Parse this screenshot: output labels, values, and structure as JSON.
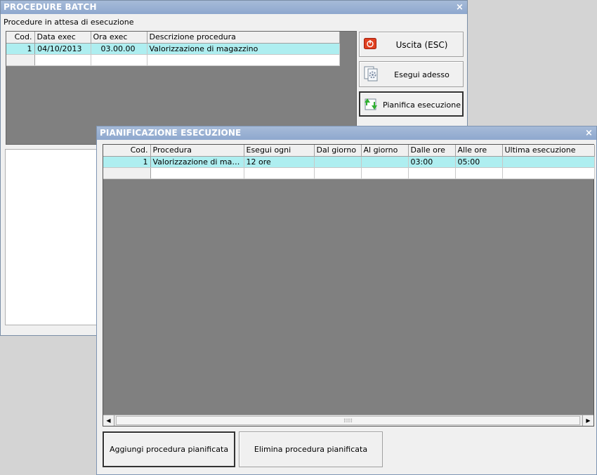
{
  "batch": {
    "title": "PROCEDURE BATCH",
    "close_glyph": "×",
    "subtitle": "Procedure in attesa di esecuzione",
    "columns": [
      "Cod.",
      "Data exec",
      "Ora exec",
      "Descrizione procedura"
    ],
    "rows": [
      [
        "1",
        "04/10/2013",
        "03.00.00",
        "Valorizzazione di magazzino"
      ]
    ],
    "buttons": {
      "exit": "Uscita (ESC)",
      "run_now": "Esegui adesso",
      "schedule": "Pianifica esecuzione"
    }
  },
  "plan": {
    "title": "PIANIFICAZIONE ESECUZIONE",
    "close_glyph": "×",
    "columns": [
      "Cod.",
      "Procedura",
      "Esegui ogni",
      "Dal giorno",
      "Al giorno",
      "Dalle ore",
      "Alle ore",
      "Ultima esecuzione"
    ],
    "rows": [
      [
        "1",
        "Valorizzazione di magazzino",
        "12 ore",
        "",
        "",
        "03:00",
        "05:00",
        ""
      ]
    ],
    "buttons": {
      "add": "Aggiungi procedura pianificata",
      "delete": "Elimina procedura pianificata"
    }
  },
  "colors": {
    "title_bar": "#8ea8ce",
    "grid_empty": "#808080",
    "selected_row": "#aeeef0",
    "exit_icon": "#e04020"
  },
  "icons": [
    "power-icon",
    "gears-document-icon",
    "calendar-arrows-icon",
    "close-icon"
  ]
}
